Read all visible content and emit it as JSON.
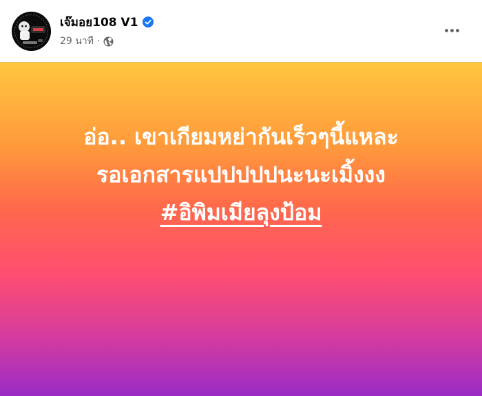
{
  "post": {
    "author": "เจ๊มอย108 V1",
    "verified": true,
    "time": "29 นาที",
    "separator": "·",
    "privacy_icon": "globe-icon",
    "more_icon": "more-options-icon",
    "text_lines": [
      "อ่อ.. เขาเกียมหย่ากันเร็วๆนี้แหละ",
      "รอเอกสารแปปปปปนะนะเมิ้งงง"
    ],
    "hashtag": "#อิพิมเมียลุงป้อม"
  },
  "colors": {
    "verified_badge": "#1877f2",
    "meta_text": "#65676b",
    "gradient_top": "#ffc63f",
    "gradient_middle": "#ff6a4a",
    "gradient_bottom": "#9a2bc6"
  }
}
